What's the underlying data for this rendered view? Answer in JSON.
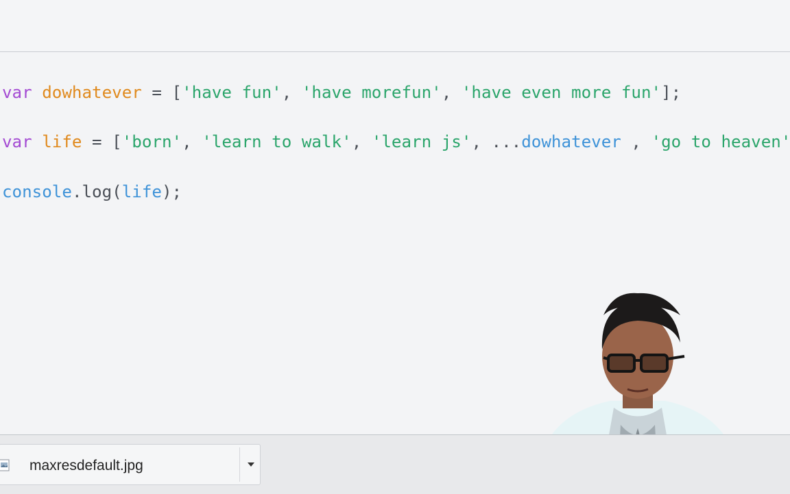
{
  "editor": {
    "line1": {
      "kw": "var",
      "name": "dowhatever",
      "op": " = [",
      "s1": "'have fun'",
      "c1": ", ",
      "s2": "'have morefun'",
      "c2": ", ",
      "s3": "'have even more fun'",
      "end": "];"
    },
    "line2": {
      "kw": "var",
      "name": "life",
      "op": " = [",
      "s1": "'born'",
      "c1": ", ",
      "s2": "'learn to walk'",
      "c2": ", ",
      "s3": "'learn js'",
      "c3": ", ...",
      "spread": "dowhatever",
      "c4": " , ",
      "s4": "'go to heaven'"
    },
    "line3": {
      "obj": "console",
      "method": ".log(",
      "arg": "life",
      "end": ");"
    }
  },
  "downloads": {
    "file_name": "maxresdefault.jpg",
    "icon": "image-file-icon",
    "menu_icon": "chevron-down-icon"
  },
  "colors": {
    "keyword": "#a44bd3",
    "variable": "#e08a1e",
    "string": "#2ba56b",
    "identifier": "#3f93d8"
  }
}
